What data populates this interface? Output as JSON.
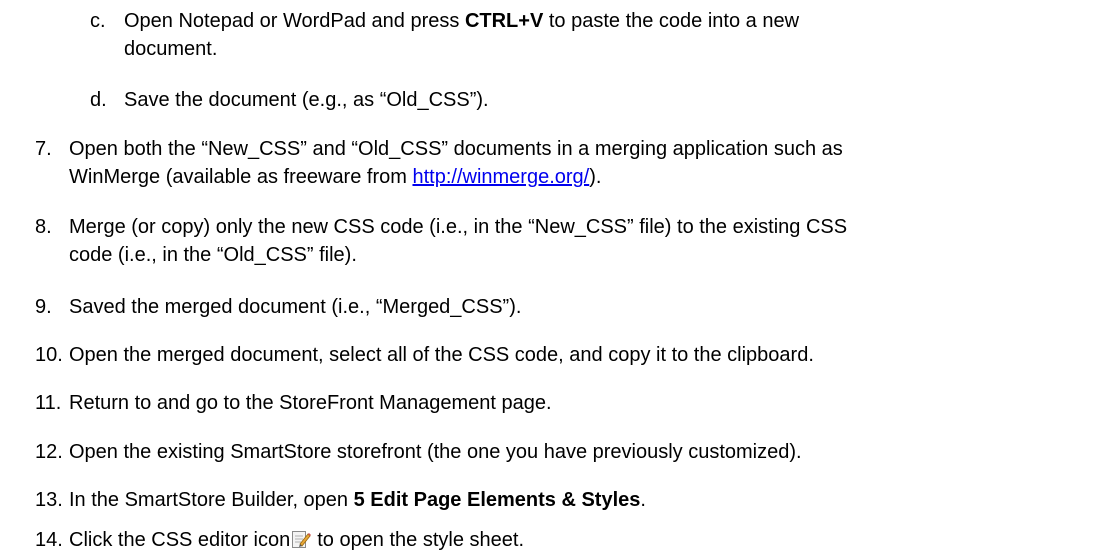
{
  "steps": {
    "c": {
      "number": "c.",
      "text_before": "Open Notepad or WordPad and press ",
      "bold": "CTRL+V",
      "text_after": " to paste the code into a new",
      "line2": "document."
    },
    "d": {
      "number": "d.",
      "text": "Save the document (e.g., as “Old_CSS”)."
    },
    "s7": {
      "number": "7.",
      "line1": "Open both the “New_CSS” and “Old_CSS” documents in a merging application such as",
      "line2_before": "WinMerge (available as freeware from ",
      "link": "http://winmerge.org/",
      "line2_after": ")."
    },
    "s8": {
      "number": "8.",
      "line1": "Merge (or copy) only the new CSS code (i.e., in the “New_CSS” file) to the existing CSS",
      "line2": "code (i.e., in the “Old_CSS” file)."
    },
    "s9": {
      "number": "9.",
      "text": "Saved the merged document (i.e., “Merged_CSS”)."
    },
    "s10": {
      "number": "10.",
      "text": "Open the merged document, select all of the CSS code, and copy it to the clipboard."
    },
    "s11": {
      "number": "11.",
      "text": "Return to  and go to the StoreFront Management page."
    },
    "s12": {
      "number": "12.",
      "text": "Open the existing SmartStore storefront (the one you have previously customized)."
    },
    "s13": {
      "number": "13.",
      "text_before": "In the SmartStore Builder, open ",
      "bold": "5 Edit Page Elements & Styles",
      "text_after": "."
    },
    "s14": {
      "number": "14.",
      "text_before": "Click the CSS editor icon",
      "icon": "css-editor-icon",
      "text_after": "to open the style sheet."
    }
  }
}
